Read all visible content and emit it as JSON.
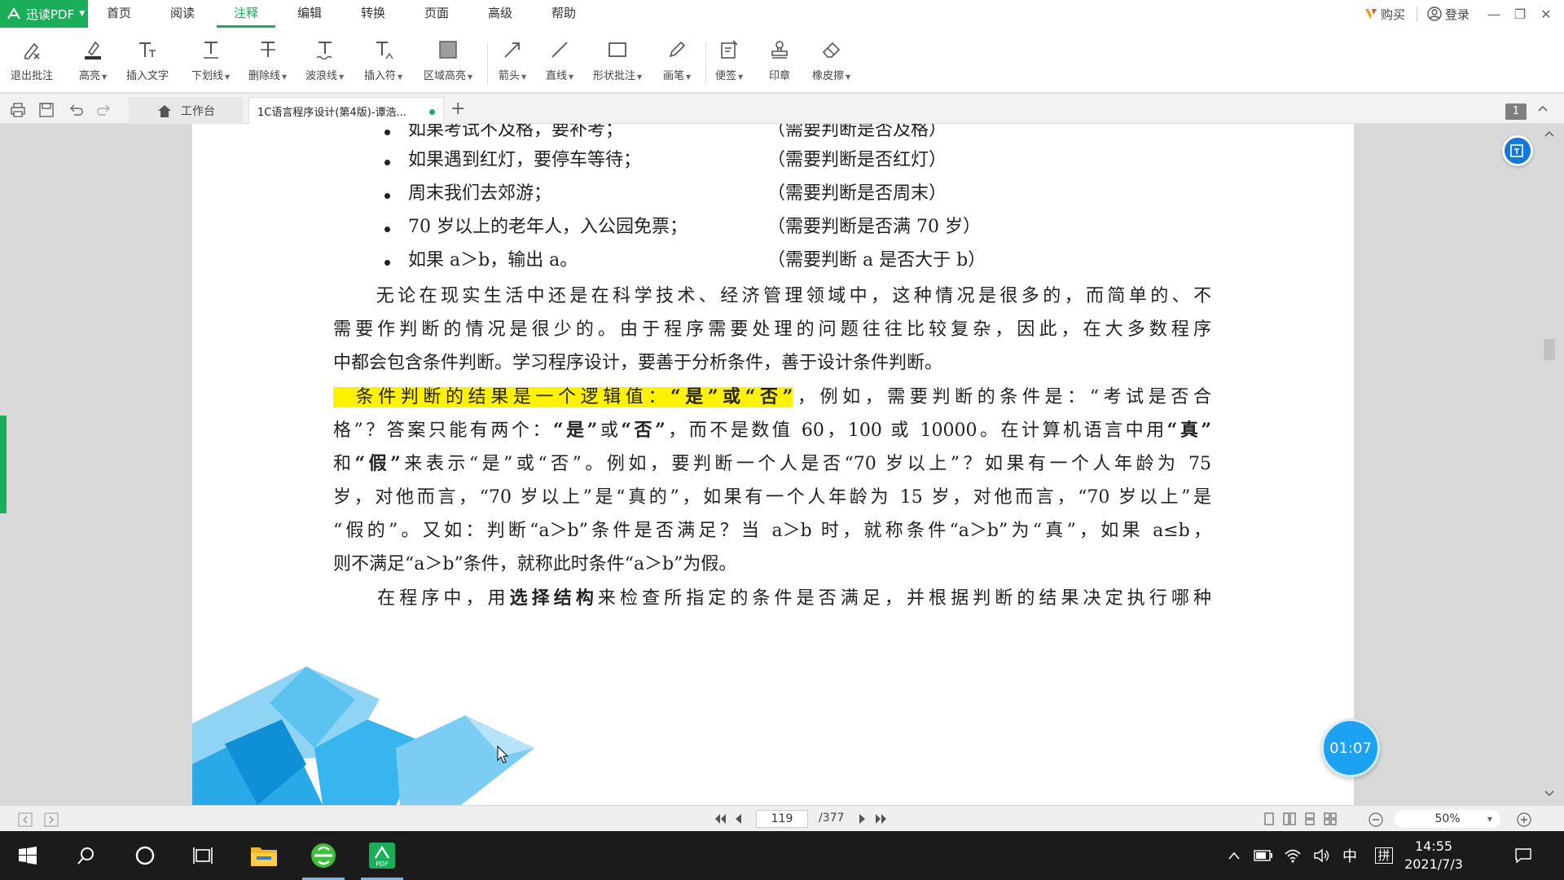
{
  "app": {
    "name": "迅读PDF"
  },
  "menu": [
    "首页",
    "阅读",
    "注释",
    "编辑",
    "转换",
    "页面",
    "高级",
    "帮助"
  ],
  "menu_active": "注释",
  "account": {
    "buy": "购买",
    "login": "登录"
  },
  "toolbar": [
    {
      "label": "退出批注",
      "icon": "exit-annotation-icon",
      "dropdown": false
    },
    {
      "label": "高亮",
      "icon": "highlight-icon",
      "dropdown": true
    },
    {
      "label": "插入文字",
      "icon": "insert-text-icon",
      "dropdown": false
    },
    {
      "label": "下划线",
      "icon": "underline-icon",
      "dropdown": true
    },
    {
      "label": "删除线",
      "icon": "strikethrough-icon",
      "dropdown": true
    },
    {
      "label": "波浪线",
      "icon": "wavy-line-icon",
      "dropdown": true
    },
    {
      "label": "插入符",
      "icon": "caret-insert-icon",
      "dropdown": true
    },
    {
      "label": "区域高亮",
      "icon": "area-highlight-icon",
      "dropdown": true
    },
    {
      "label": "箭头",
      "icon": "arrow-icon",
      "dropdown": true
    },
    {
      "label": "直线",
      "icon": "line-icon",
      "dropdown": true
    },
    {
      "label": "形状批注",
      "icon": "shape-icon",
      "dropdown": true
    },
    {
      "label": "画笔",
      "icon": "pen-icon",
      "dropdown": true
    },
    {
      "label": "便签",
      "icon": "note-icon",
      "dropdown": true
    },
    {
      "label": "印章",
      "icon": "stamp-icon",
      "dropdown": false
    },
    {
      "label": "橡皮擦",
      "icon": "eraser-icon",
      "dropdown": true
    }
  ],
  "tabs": {
    "home": "工作台",
    "document": "1C语言程序设计(第4版)-谭浩..."
  },
  "page_badge": "1",
  "content": {
    "bullets": [
      {
        "left": "如果考试不及格，要补考；",
        "right": "（需要判断是否及格）"
      },
      {
        "left": "如果遇到红灯，要停车等待；",
        "right": "（需要判断是否红灯）"
      },
      {
        "left": "周末我们去郊游；",
        "right": "（需要判断是否周末）"
      },
      {
        "left": "70 岁以上的老年人，入公园免票；",
        "right": "（需要判断是否满 70 岁）"
      },
      {
        "left": "如果 a＞b，输出 a。",
        "right": "（需要判断 a 是否大于 b）"
      }
    ],
    "p1": [
      "　　无论在现实生活中还是在科学技术、经济管理领域中，这种情况是很多的，而简单的、不",
      "需要作判断的情况是很少的。由于程序需要处理的问题往往比较复杂，因此，在大多数程序",
      "中都会包含条件判断。学习程序设计，要善于分析条件，善于设计条件判断。"
    ],
    "p2_highlight_a": "条件判断的结果是一个逻辑值：",
    "p2_highlight_b": "“是”或“否”",
    "p2_after": "，例如，需要判断的条件是：“考试是否合",
    "p2_l2_a": "格”？答案只能有两个：",
    "p2_l2_b": "“是”",
    "p2_l2_c": "或",
    "p2_l2_d": "“否”",
    "p2_l2_e": "，而不是数值 60，100 或 10000。在计算机语言中用",
    "p2_l2_f": "“真”",
    "p2_l3_a": "和",
    "p2_l3_b": "“假”",
    "p2_l3_c": "来表示“是”或“否”。例如，要判断一个人是否“70 岁以上”？如果有一个人年龄为 75",
    "p2_l4": "岁，对他而言，“70 岁以上”是“真的”，如果有一个人年龄为 15 岁，对他而言，“70 岁以上”是",
    "p2_l5": "“假的”。又如：判断“a＞b”条件是否满足？当 a＞b 时，就称条件“a＞b”为“真”，如果 a≤b，",
    "p2_l6": "则不满足“a＞b”条件，就称此时条件“a＞b”为假。",
    "p3_a": "在程序中，用",
    "p3_b": "选择结构",
    "p3_c": "来检查所指定的条件是否满足，并根据判断的结果决定执行哪种"
  },
  "timer": "01:07",
  "status": {
    "current_page": "119",
    "total_pages": "/377",
    "zoom": "50%"
  },
  "taskbar": {
    "time": "14:55",
    "date": "2021/7/3",
    "ime_lang": "中",
    "ime_mode": "拼"
  },
  "colors": {
    "brand_green": "#1aad5a",
    "highlight_yellow": "#fff200",
    "timer_blue": "#1da1f2"
  }
}
